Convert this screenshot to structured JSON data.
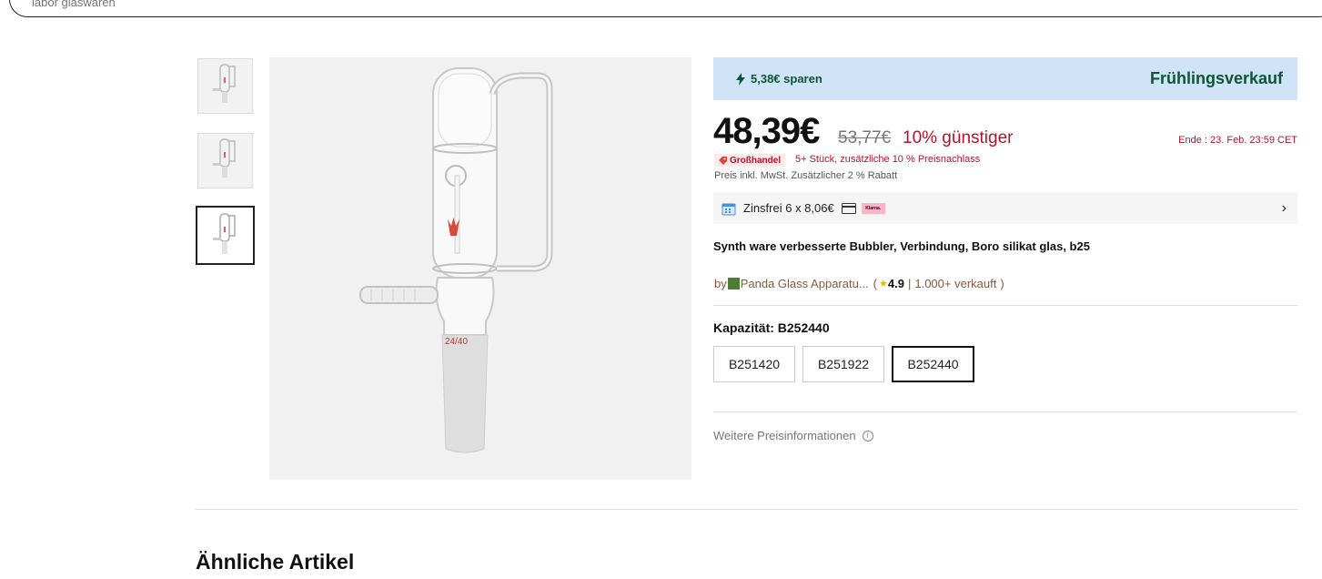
{
  "search": {
    "placeholder": "labor glaswaren"
  },
  "gallery": {
    "thumbnails": [
      "thumb-1",
      "thumb-2",
      "thumb-3"
    ],
    "active_index": 2,
    "main_image_label": "24/40"
  },
  "promo": {
    "save_text": "5,38€ sparen",
    "title": "Frühlingsverkauf",
    "background": "#cfe5f7",
    "text_color": "#0f5436"
  },
  "pricing": {
    "price": "48,39€",
    "old_price": "53,77€",
    "discount": "10% günstiger",
    "sale_end": "Ende :  23. Feb. 23:59 CET",
    "wholesale_badge": "Großhandel",
    "wholesale_text": "5+ Stück, zusätzliche 10 % Preisnachlass",
    "tax_note": "Preis inkl. MwSt. Zusätzlicher 2 % Rabatt",
    "accent_color": "#b3142b"
  },
  "installment": {
    "text": "Zinsfrei 6 x 8,06€",
    "provider": "Klarna."
  },
  "product": {
    "title": "Synth ware verbesserte Bubbler, Verbindung, Boro silikat glas, b25"
  },
  "seller": {
    "prefix": "by",
    "name": "Panda Glass Apparatu...",
    "open_paren": "(",
    "rating": "4.9",
    "separator": "|",
    "sold": "1.000+ verkauft",
    "close_paren": ")"
  },
  "capacity": {
    "label": "Kapazität: B252440",
    "options": [
      "B251420",
      "B251922",
      "B252440"
    ],
    "selected": "B252440"
  },
  "more_info": {
    "label": "Weitere Preisinformationen",
    "icon": "i"
  },
  "similar": {
    "heading": "Ähnliche Artikel"
  }
}
